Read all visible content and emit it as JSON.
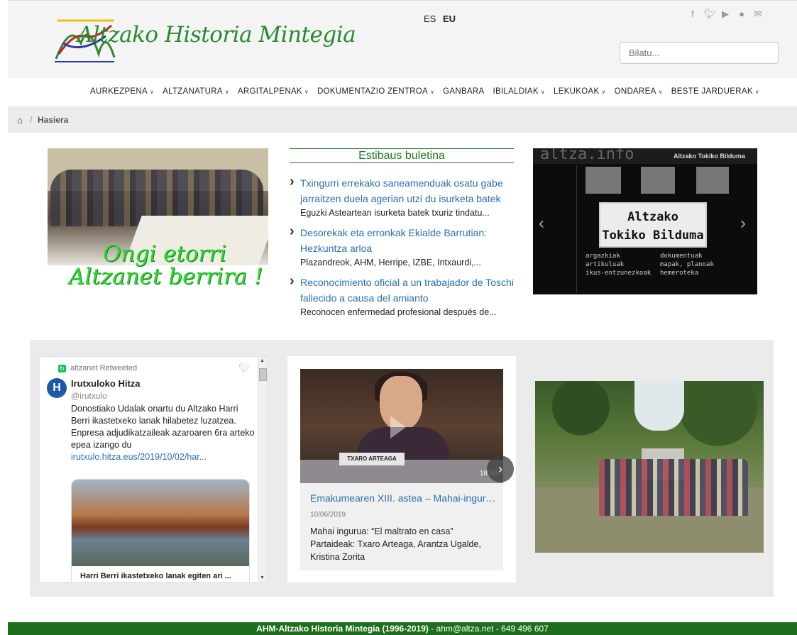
{
  "header": {
    "logo_text": "Altzako Historia Mintegia",
    "languages": [
      "ES",
      "EU"
    ],
    "active_language": "EU",
    "search_placeholder": "Bilatu...",
    "social_icons": [
      "facebook-icon",
      "twitter-icon",
      "youtube-icon",
      "flickr-icon",
      "email-icon"
    ]
  },
  "nav": {
    "items": [
      {
        "label": "AURKEZPENA",
        "dropdown": true
      },
      {
        "label": "ALTZANATURA",
        "dropdown": true
      },
      {
        "label": "ARGITALPENAK",
        "dropdown": true
      },
      {
        "label": "DOKUMENTAZIO ZENTROA",
        "dropdown": true
      },
      {
        "label": "GANBARA",
        "dropdown": false
      },
      {
        "label": "IBILALDIAK",
        "dropdown": true
      },
      {
        "label": "LEKUKOAK",
        "dropdown": true
      },
      {
        "label": "ONDAREA",
        "dropdown": true
      },
      {
        "label": "BESTE JARDUERAK",
        "dropdown": true
      }
    ]
  },
  "breadcrumb": {
    "current": "Hasiera"
  },
  "welcome": {
    "line1": "Ongi etorri",
    "line2": "Altzanet berrira !"
  },
  "estibaus": {
    "title": "Estibaus buletina",
    "items": [
      {
        "title": "Txingurri errekako saneamenduak osatu gabe jarraitzen duela agerian utzi du isurketa batek",
        "summary": "Eguzki Asteartean isurketa batek txuriz tindatu..."
      },
      {
        "title": "Desorekak eta erronkak Ekialde Barrutian: Hezkuntza arloa",
        "summary": "Plazandreok, AHM, Herripe, IZBE, Intxaurdi,..."
      },
      {
        "title": "Reconocimiento oficial a un trabajador de Toschi fallecido a causa del amianto",
        "summary": "Reconocen enfermedad profesional después de..."
      }
    ]
  },
  "altzainfo": {
    "brand": "altza.info",
    "header_title": "Altzako Tokiko Bilduma",
    "box_line1": "Altzako",
    "box_line2": "Tokiko Bilduma",
    "links": [
      "argazkiak",
      "dokumentuak",
      "artikuluak",
      "mapak, planoak",
      "ikus-entzunezkoak",
      "hemeroteka"
    ]
  },
  "twitter": {
    "retweeted": "altzanet Retweeted",
    "name": "Irutxuloko Hitza",
    "handle": "@irutxulo",
    "avatar_letter": "H",
    "text": "Donostiako Udalak onartu du Altzako Harri Berri ikastetxeko lanak hilabetez luzatzea. Enpresa adjudikatzaileak azaroaren 6ra arteko epea izango du",
    "link": "irutxulo.hitza.eus/2019/10/02/har...",
    "card_title": "Harri Berri ikastetxeko lanak egiten ari ..."
  },
  "video": {
    "nameplate": "TXARO ARTEAGA",
    "duration": "18:58",
    "title": "Emakumearen XIII. astea – Mahai-inguru...",
    "date": "10/06/2019",
    "description": "Mahai ingurua: “El maltrato en casa” Partaideak: Txaro Arteaga, Arantza Ugalde, Kristina Zorita"
  },
  "footer": {
    "org": "AHM-Altzako Historia Mintegia (1996-2019)",
    "contact": " - ahm@altza.net - 649 496 607"
  }
}
